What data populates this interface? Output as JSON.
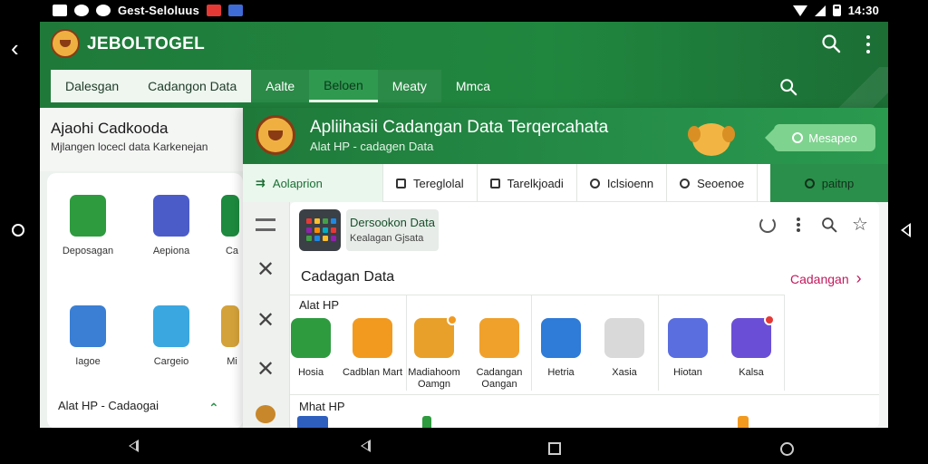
{
  "status_bar": {
    "text": "Gest-Seloluus",
    "time": "14:30"
  },
  "app": {
    "title": "JEBOLTOGEL"
  },
  "tabs": [
    {
      "label": "Dalesgan"
    },
    {
      "label": "Cadangon Data"
    },
    {
      "label": "Aalte"
    },
    {
      "label": "Beloen"
    },
    {
      "label": "Meaty"
    },
    {
      "label": "Mmca"
    }
  ],
  "left_panel": {
    "title": "Ajaohi Cadkooda",
    "subtitle": "Mjlangen locecl data Karkenejan",
    "items": [
      {
        "label": "Deposagan",
        "icon": "phone-backup-icon",
        "color": "#2e9b3f"
      },
      {
        "label": "Aepiona",
        "icon": "phone-sync-icon",
        "color": "#4b5cc9"
      },
      {
        "label": "Ca",
        "icon": "phone-icon",
        "color": "#1d8a3f"
      },
      {
        "label": "Iagoe",
        "icon": "document-chart-icon",
        "color": "#3a7fd4"
      },
      {
        "label": "Cargeio",
        "icon": "phone-restore-icon",
        "color": "#3aa7e0"
      },
      {
        "label": "Mi",
        "icon": "tablet-icon",
        "color": "#d4a23a"
      }
    ],
    "footer": "Alat HP - Cadaogai"
  },
  "sheet": {
    "title": "Apliihasii Cadangan Data Terqercahata",
    "subtitle": "Alat HP - cadagen Data",
    "button": "Mesapeo",
    "subtabs": [
      {
        "label": "Aolaprion",
        "icon": "arrow-icon"
      },
      {
        "label": "Tereglolal",
        "icon": "box-icon"
      },
      {
        "label": "Tarelkjoadi",
        "icon": "box-icon"
      },
      {
        "label": "Iclsioenn",
        "icon": "clock-icon"
      },
      {
        "label": "Seoenoe",
        "icon": "minus-circle-icon"
      },
      {
        "label": "paitnp",
        "icon": "person-icon"
      }
    ],
    "card": {
      "title": "Dersookon Data",
      "subtitle": "Kealagan Gjsata"
    },
    "section": {
      "title": "Cadagan Data",
      "link": "Cadangan"
    },
    "group1": "Alat HP",
    "apps": [
      {
        "label": "Hosia",
        "icon": "cloud-check-icon",
        "color": "#2e9b3f"
      },
      {
        "label": "Cadblan Mart",
        "icon": "triangle-warning-icon",
        "color": "#f29a1f"
      },
      {
        "label": "Madiahoom Oamgn",
        "icon": "phone-grid-icon",
        "color": "#e8a02a"
      },
      {
        "label": "Cadangan Oangan",
        "icon": "document-list-icon",
        "color": "#f0a12c"
      },
      {
        "label": "Hetria",
        "icon": "folder-icon",
        "color": "#2e7bd8"
      },
      {
        "label": "Xasia",
        "icon": "books-icon",
        "color": "#d9d9d9"
      },
      {
        "label": "Hiotan",
        "icon": "send-icon",
        "color": "#5a6ee0"
      },
      {
        "label": "Kalsa",
        "icon": "compass-icon",
        "color": "#6a4fd6"
      }
    ],
    "group2": "Mhat HP"
  }
}
